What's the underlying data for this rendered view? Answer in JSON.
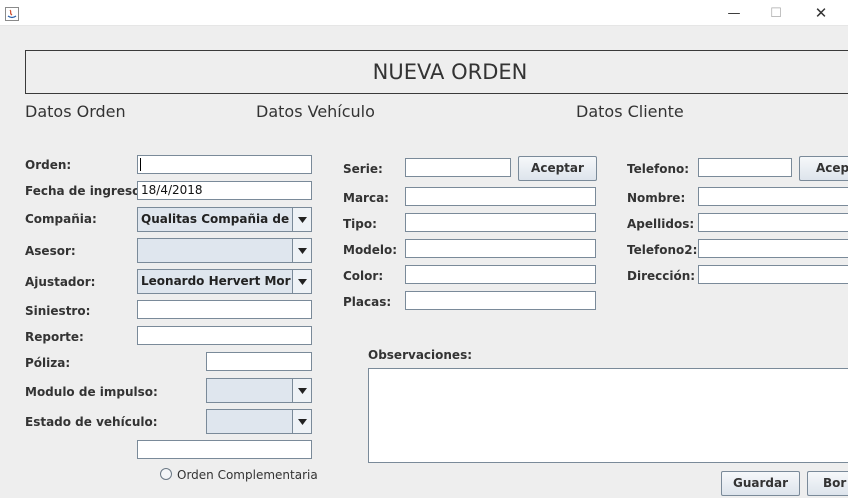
{
  "window": {
    "minimize_glyph": "—",
    "maximize_glyph": "☐",
    "close_glyph": "✕"
  },
  "header": {
    "title": "NUEVA ORDEN"
  },
  "sections": {
    "orden": "Datos Orden",
    "vehiculo": "Datos Vehículo",
    "cliente": "Datos Cliente"
  },
  "orden": {
    "orden_label": "Orden:",
    "orden_value": "",
    "fecha_label": "Fecha de ingreso:",
    "fecha_value": "18/4/2018",
    "compania_label": "Compañia:",
    "compania_value": "Qualitas Compañia de Se...",
    "asesor_label": "Asesor:",
    "asesor_value": "",
    "ajustador_label": "Ajustador:",
    "ajustador_value": "Leonardo Hervert Morales",
    "siniestro_label": "Siniestro:",
    "siniestro_value": "",
    "reporte_label": "Reporte:",
    "reporte_value": "",
    "poliza_label": "Póliza:",
    "poliza_value": "",
    "modulo_label": "Modulo de impulso:",
    "modulo_value": "",
    "estado_label": "Estado de vehículo:",
    "estado_value": "",
    "extra_value": "",
    "complementaria_label": "Orden Complementaria"
  },
  "vehiculo": {
    "serie_label": "Serie:",
    "serie_value": "",
    "aceptar_label": "Aceptar",
    "marca_label": "Marca:",
    "marca_value": "",
    "tipo_label": "Tipo:",
    "tipo_value": "",
    "modelo_label": "Modelo:",
    "modelo_value": "",
    "color_label": "Color:",
    "color_value": "",
    "placas_label": "Placas:",
    "placas_value": ""
  },
  "cliente": {
    "telefono_label": "Telefono:",
    "telefono_value": "",
    "aceptar_label": "Acep",
    "nombre_label": "Nombre:",
    "nombre_value": "",
    "apellidos_label": "Apellidos:",
    "apellidos_value": "",
    "telefono2_label": "Telefono2:",
    "telefono2_value": "",
    "direccion_label": "Dirección:",
    "direccion_value": ""
  },
  "observaciones": {
    "label": "Observaciones:",
    "value": ""
  },
  "footer": {
    "guardar_label": "Guardar",
    "borrar_label": "Bor"
  }
}
